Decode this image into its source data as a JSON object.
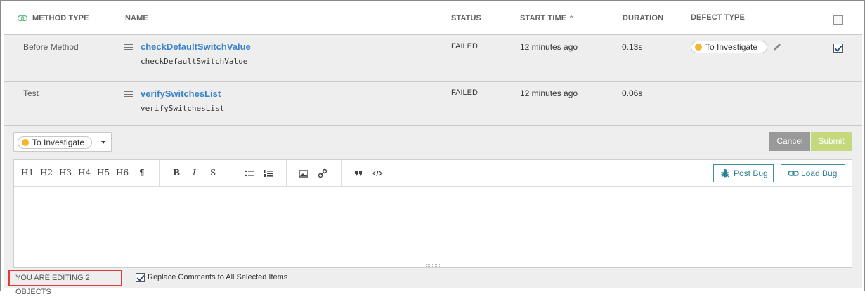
{
  "header": {
    "method_type": "METHOD TYPE",
    "name": "NAME",
    "status": "STATUS",
    "start_time": "START TIME",
    "duration": "DURATION",
    "defect_type": "DEFECT TYPE"
  },
  "rows": [
    {
      "method_type": "Before Method",
      "name_link": "checkDefaultSwitchValue",
      "name_code": "checkDefaultSwitchValue",
      "status": "FAILED",
      "start_time": "12 minutes ago",
      "duration": "0.13s",
      "defect_type": "To Investigate",
      "selected": true
    },
    {
      "method_type": "Test",
      "name_link": "verifySwitchesList",
      "name_code": "verifySwitchesList",
      "status": "FAILED",
      "start_time": "12 minutes ago",
      "duration": "0.06s",
      "defect_type": "",
      "selected": false
    }
  ],
  "editor": {
    "defect_dropdown": "To Investigate",
    "cancel_label": "Cancel",
    "submit_label": "Submit",
    "toolbar": {
      "h1": "H1",
      "h2": "H2",
      "h3": "H3",
      "h4": "H4",
      "h5": "H5",
      "h6": "H6",
      "paragraph": "¶",
      "bold": "B",
      "italic": "I",
      "strike": "S"
    },
    "post_bug": "Post Bug",
    "load_bug": "Load Bug"
  },
  "footer": {
    "editing_text": "YOU ARE EDITING 2 OBJECTS",
    "replace_label": "Replace Comments to All Selected Items",
    "replace_checked": true
  },
  "colors": {
    "to_investigate_dot": "#f7b52c",
    "link_blue": "#3a84c9",
    "submit_bg": "#c4d87c",
    "cancel_bg": "#999999",
    "outline_teal": "#3f8fa0",
    "highlight_red": "#e03a3a"
  }
}
